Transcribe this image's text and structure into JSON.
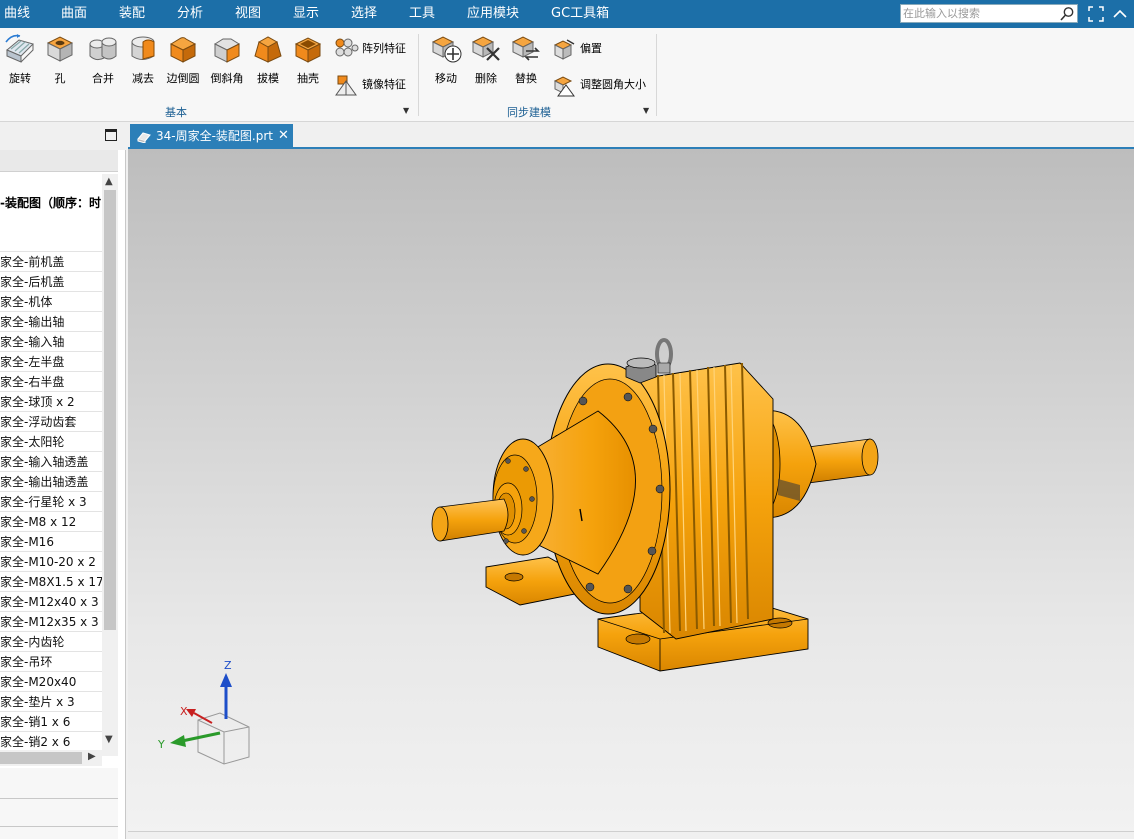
{
  "menu": {
    "items": [
      "曲线",
      "曲面",
      "装配",
      "分析",
      "视图",
      "显示",
      "选择",
      "工具",
      "应用模块",
      "GC工具箱"
    ],
    "search_placeholder": "在此输入以搜索"
  },
  "ribbon": {
    "basic": {
      "buttons": [
        "旋转",
        "孔",
        "合并",
        "减去",
        "边倒圆",
        "倒斜角",
        "拔模",
        "抽壳"
      ],
      "small": [
        "阵列特征",
        "镜像特征"
      ],
      "group_label": "基本"
    },
    "sync": {
      "buttons": [
        "移动",
        "删除",
        "替换"
      ],
      "small": [
        "偏置",
        "调整圆角大小"
      ],
      "group_label": "同步建模"
    },
    "accent_color": "#f08a1c"
  },
  "tree": {
    "root_label": "-装配图（顺序：时.",
    "items": [
      "家全-前机盖",
      "家全-后机盖",
      "家全-机体",
      "家全-输出轴",
      "家全-输入轴",
      "家全-左半盘",
      "家全-右半盘",
      "家全-球顶 x 2",
      "家全-浮动齿套",
      "家全-太阳轮",
      "家全-输入轴透盖",
      "家全-输出轴透盖",
      "家全-行星轮 x 3",
      "家全-M8 x 12",
      "家全-M16",
      "家全-M10-20 x 2",
      "家全-M8X1.5 x 17",
      "家全-M12x40 x 3",
      "家全-M12x35 x 3",
      "家全-内齿轮",
      "家全-吊环",
      "家全-M20x40",
      "家全-垫片 x 3",
      "家全-销1 x 6",
      "家全-销2 x 6"
    ]
  },
  "document_tab": {
    "title": "34-周家全-装配图.prt"
  },
  "triad": {
    "z": "Z",
    "x": "X",
    "y": "Y"
  },
  "colors": {
    "menubar": "#1c6fa8",
    "tab": "#2c7fb8",
    "model": "#f5a20c",
    "model_dark": "#c97a00"
  }
}
